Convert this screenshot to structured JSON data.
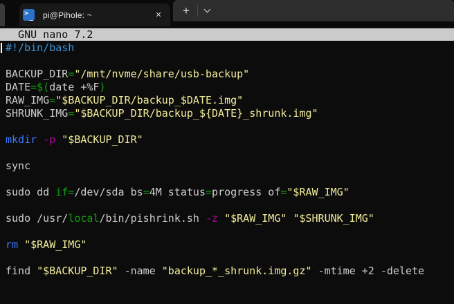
{
  "window": {
    "tab": {
      "title": "pi@Pihole: ~",
      "close_glyph": "✕"
    },
    "new_tab_label": "+"
  },
  "editor": {
    "header": "  GNU nano 7.2"
  },
  "palette": {
    "background": "#0C0C0C",
    "foreground": "#CCCCCC",
    "green": "#13A10E",
    "yellow": "#F2EC9B",
    "blue": "#3B78FF",
    "cyan": "#3A96DD",
    "magenta": "#B4009E",
    "nano_bar_bg": "#CBCBCB",
    "nano_bar_fg": "#0C0C0C"
  },
  "terminal": {
    "cursor_line": 0,
    "lines": [
      [
        [
          "cyan",
          "#!/bin/bash"
        ]
      ],
      [],
      [
        [
          "fg",
          "BACKUP_DIR"
        ],
        [
          "green",
          "="
        ],
        [
          "yellow",
          "\"/mnt/nvme/share/usb-backup\""
        ]
      ],
      [
        [
          "fg",
          "DATE"
        ],
        [
          "green",
          "=$("
        ],
        [
          "fg",
          "date +%F"
        ],
        [
          "green",
          ")"
        ]
      ],
      [
        [
          "fg",
          "RAW_IMG"
        ],
        [
          "green",
          "="
        ],
        [
          "yellow",
          "\"$BACKUP_DIR/backup_$DATE.img\""
        ]
      ],
      [
        [
          "fg",
          "SHRUNK_IMG"
        ],
        [
          "green",
          "="
        ],
        [
          "yellow",
          "\"$BACKUP_DIR/backup_${DATE}_shrunk.img\""
        ]
      ],
      [],
      [
        [
          "blue",
          "mkdir"
        ],
        [
          "fg",
          " "
        ],
        [
          "magenta",
          "-p"
        ],
        [
          "fg",
          " "
        ],
        [
          "yellow",
          "\"$BACKUP_DIR\""
        ]
      ],
      [],
      [
        [
          "fg",
          "sync"
        ]
      ],
      [],
      [
        [
          "fg",
          "sudo dd "
        ],
        [
          "green",
          "if="
        ],
        [
          "fg",
          "/dev/sda bs"
        ],
        [
          "green",
          "="
        ],
        [
          "fg",
          "4M status"
        ],
        [
          "green",
          "="
        ],
        [
          "fg",
          "progress of"
        ],
        [
          "green",
          "="
        ],
        [
          "yellow",
          "\"$RAW_IMG\""
        ]
      ],
      [],
      [
        [
          "fg",
          "sudo /usr/"
        ],
        [
          "green",
          "local"
        ],
        [
          "fg",
          "/bin/pishrink.sh "
        ],
        [
          "magenta",
          "-z"
        ],
        [
          "fg",
          " "
        ],
        [
          "yellow",
          "\"$RAW_IMG\""
        ],
        [
          "fg",
          " "
        ],
        [
          "yellow",
          "\"$SHRUNK_IMG\""
        ]
      ],
      [],
      [
        [
          "blue",
          "rm"
        ],
        [
          "fg",
          " "
        ],
        [
          "yellow",
          "\"$RAW_IMG\""
        ]
      ],
      [],
      [
        [
          "fg",
          "find "
        ],
        [
          "yellow",
          "\"$BACKUP_DIR\""
        ],
        [
          "fg",
          " -name "
        ],
        [
          "yellow",
          "\"backup_*_shrunk.img.gz\""
        ],
        [
          "fg",
          " -mtime +2 -delete"
        ]
      ]
    ]
  }
}
